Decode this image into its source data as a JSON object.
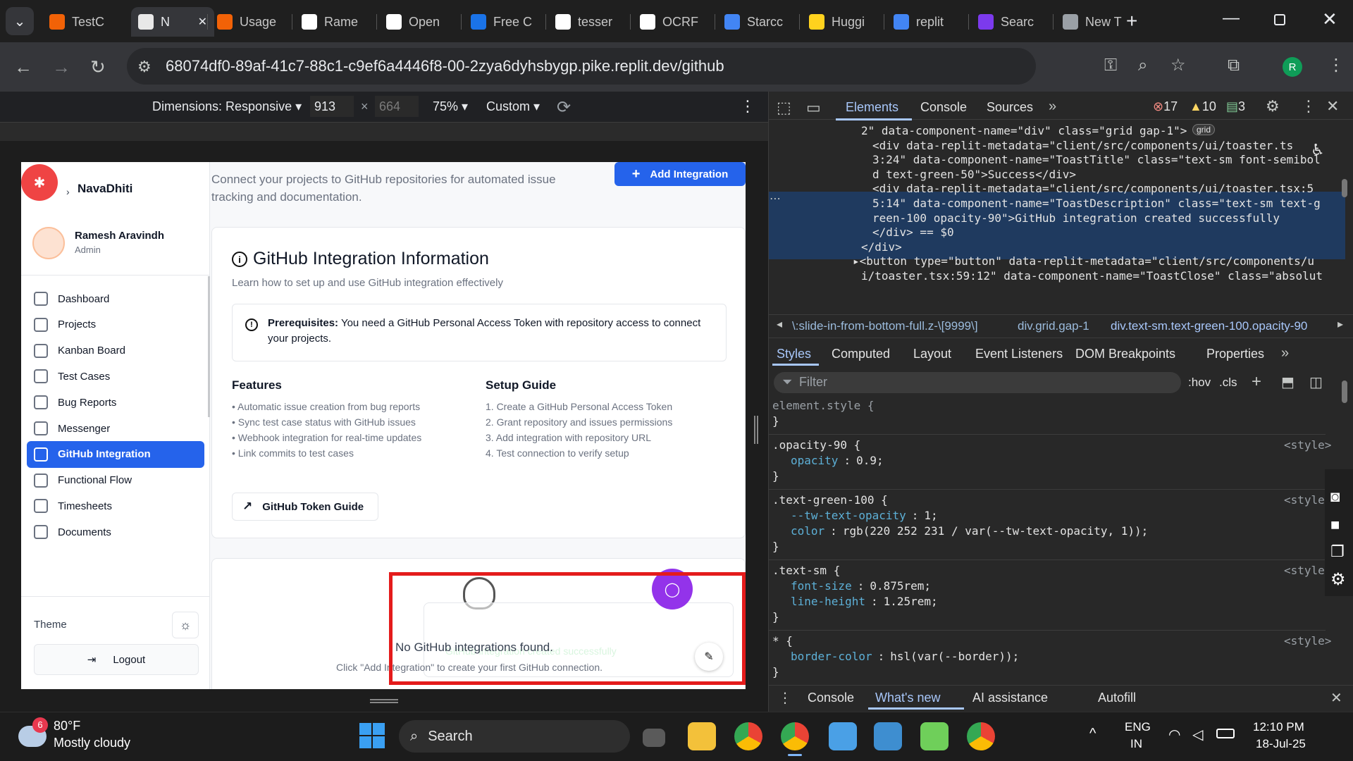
{
  "browser": {
    "tabs": [
      {
        "label": "TestC",
        "favicon_color": "#f26207"
      },
      {
        "label": "N",
        "favicon_color": "#e8e8e8"
      },
      {
        "label": "Usage",
        "favicon_color": "#f26207"
      },
      {
        "label": "Rame",
        "favicon_color": "#ffffff"
      },
      {
        "label": "Open",
        "favicon_color": "#ffffff"
      },
      {
        "label": "Free C",
        "favicon_color": "#1a73e8"
      },
      {
        "label": "tesser",
        "favicon_color": "#ffffff"
      },
      {
        "label": "OCRF",
        "favicon_color": "#ffffff"
      },
      {
        "label": "Starcc",
        "favicon_color": "#4285f4"
      },
      {
        "label": "Huggi",
        "favicon_color": "#ffd21e"
      },
      {
        "label": "replit",
        "favicon_color": "#4285f4"
      },
      {
        "label": "Searc",
        "favicon_color": "#7c3aed"
      },
      {
        "label": "New T",
        "favicon_color": "#9aa0a6"
      }
    ],
    "url": "68074df0-89af-41c7-88c1-c9ef6a4446f8-00-2zya6dyhsbygp.pike.replit.dev/github",
    "profile_initial": "R"
  },
  "device_toolbar": {
    "dimensions_label": "Dimensions: Responsive ▾",
    "width": "913",
    "x": "×",
    "height": "664",
    "zoom": "75% ▾",
    "throttle": "Custom ▾"
  },
  "app": {
    "brand": "NavaDhiti",
    "user": {
      "name": "Ramesh Aravindh",
      "role": "Admin"
    },
    "nav": [
      {
        "label": "Dashboard",
        "active": false
      },
      {
        "label": "Projects",
        "active": false
      },
      {
        "label": "Kanban Board",
        "active": false
      },
      {
        "label": "Test Cases",
        "active": false
      },
      {
        "label": "Bug Reports",
        "active": false
      },
      {
        "label": "Messenger",
        "active": false
      },
      {
        "label": "GitHub Integration",
        "active": true
      },
      {
        "label": "Functional Flow",
        "active": false
      },
      {
        "label": "Timesheets",
        "active": false
      },
      {
        "label": "Documents",
        "active": false
      }
    ],
    "theme_label": "Theme",
    "logout_label": "Logout",
    "page_subtitle": "Connect your projects to GitHub repositories for automated issue tracking and documentation.",
    "add_button": "Add Integration",
    "info": {
      "title": "GitHub Integration Information",
      "subtitle": "Learn how to set up and use GitHub integration effectively",
      "prereq_bold": "Prerequisites:",
      "prereq_text": " You need a GitHub Personal Access Token with repository access to connect your projects.",
      "features_title": "Features",
      "features": [
        "• Automatic issue creation from bug reports",
        "• Sync test case status with GitHub issues",
        "• Webhook integration for real-time updates",
        "• Link commits to test cases"
      ],
      "setup_title": "Setup Guide",
      "setup": [
        "1. Create a GitHub Personal Access Token",
        "2. Grant repository and issues permissions",
        "3. Add integration with repository URL",
        "4. Test connection to verify setup"
      ],
      "token_guide": "GitHub Token Guide"
    },
    "empty": {
      "title": "No GitHub integrations found.",
      "hint": "Click \"Add Integration\" to create your first GitHub connection.",
      "toast_ghost": "GitHub integration created successfully"
    }
  },
  "devtools": {
    "tabs": [
      "Elements",
      "Console",
      "Sources"
    ],
    "errors": "17",
    "warnings": "10",
    "messages": "3",
    "dom_lines": [
      "2\" data-component-name=\"div\" class=\"grid gap-1\">",
      "<div data-replit-metadata=\"client/src/components/ui/toaster.ts",
      "3:24\" data-component-name=\"ToastTitle\" class=\"text-sm font-semibol",
      "d text-green-50\">Success</div>",
      "<div data-replit-metadata=\"client/src/components/ui/toaster.tsx:5",
      "5:14\" data-component-name=\"ToastDescription\" class=\"text-sm text-g",
      "reen-100 opacity-90\">GitHub integration created successfully",
      "</div> == $0",
      "</div>",
      "▸<button type=\"button\" data-replit-metadata=\"client/src/components/u",
      "i/toaster.tsx:59:12\" data-component-name=\"ToastClose\" class=\"absolut"
    ],
    "grid_badge": "grid",
    "breadcrumbs": [
      "\\:slide-in-from-bottom-full.z-\\[9999\\]",
      "div.grid.gap-1",
      "div.text-sm.text-green-100.opacity-90"
    ],
    "style_tabs": [
      "Styles",
      "Computed",
      "Layout",
      "Event Listeners",
      "DOM Breakpoints",
      "Properties"
    ],
    "filter_placeholder": "Filter",
    "hov": ":hov",
    "cls": ".cls",
    "rules": [
      {
        "selector": "element.style {",
        "decls": [],
        "source": ""
      },
      {
        "selector": ".opacity-90 {",
        "decls": [
          [
            "opacity",
            "0.9;"
          ]
        ],
        "source": "<style>"
      },
      {
        "selector": ".text-green-100 {",
        "decls": [
          [
            "--tw-text-opacity",
            "1;"
          ],
          [
            "color",
            "rgb(220 252 231 / var(--tw-text-opacity, 1));"
          ]
        ],
        "source": "<style>"
      },
      {
        "selector": ".text-sm {",
        "decls": [
          [
            "font-size",
            "0.875rem;"
          ],
          [
            "line-height",
            "1.25rem;"
          ]
        ],
        "source": "<style>"
      },
      {
        "selector": "* {",
        "decls": [
          [
            "border-color",
            "hsl(var(--border));"
          ]
        ],
        "source": "<style>"
      }
    ],
    "drawer_tabs": [
      "Console",
      "What's new",
      "AI assistance",
      "Autofill"
    ]
  },
  "taskbar": {
    "weather_badge": "6",
    "temp": "80°F",
    "condition": "Mostly cloudy",
    "search": "Search",
    "lang": "ENG",
    "region": "IN",
    "time": "12:10 PM",
    "date": "18-Jul-25"
  }
}
